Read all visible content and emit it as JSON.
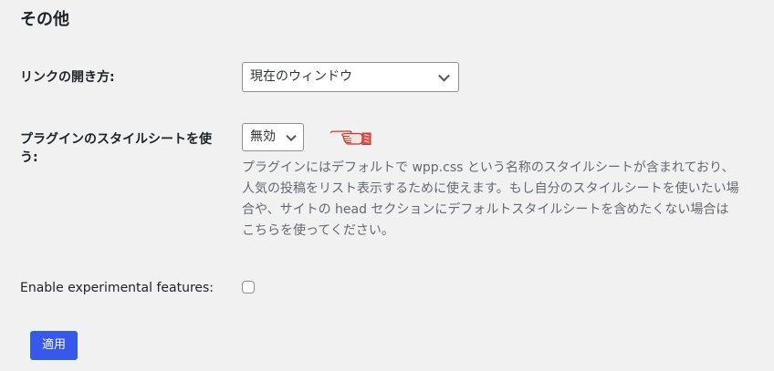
{
  "section": {
    "title": "その他"
  },
  "link_open": {
    "label": "リンクの開き方:",
    "value": "現在のウィンドウ"
  },
  "plugin_style": {
    "label": "プラグインのスタイルシートを使う:",
    "value": "無効",
    "description": "プラグインにはデフォルトで wpp.css という名称のスタイルシートが含まれており、人気の投稿をリスト表示するために使えます。もし自分のスタイルシートを使いたい場合や、サイトの head セクションにデフォルトスタイルシートを含めたくない場合はこちらを使ってください。"
  },
  "experimental": {
    "label": "Enable experimental features:",
    "checked": false
  },
  "apply_button": {
    "label": "適用",
    "color": "#3858e9"
  },
  "icons": {
    "pointer": "pointing-hand-icon"
  }
}
